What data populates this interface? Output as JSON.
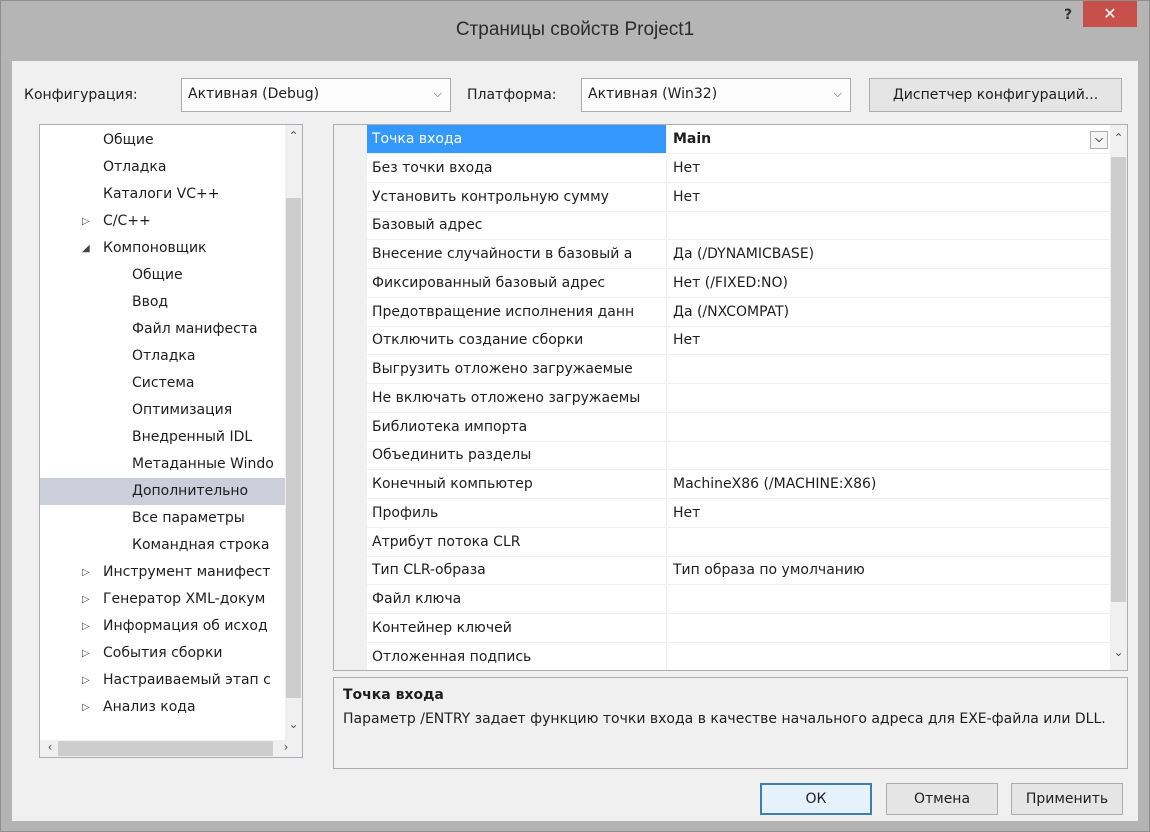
{
  "window": {
    "title": "Страницы свойств Project1",
    "help_label": "?",
    "close_label": "✕"
  },
  "toolbar": {
    "config_label": "Конфигурация:",
    "config_value": "Активная (Debug)",
    "platform_label": "Платформа:",
    "platform_value": "Активная (Win32)",
    "config_manager_label": "Диспетчер конфигураций..."
  },
  "tree": {
    "items": [
      {
        "label": "Общие",
        "indent": 0,
        "toggle": ""
      },
      {
        "label": "Отладка",
        "indent": 0,
        "toggle": ""
      },
      {
        "label": "Каталоги VC++",
        "indent": 0,
        "toggle": ""
      },
      {
        "label": "C/C++",
        "indent": 0,
        "toggle": "▷"
      },
      {
        "label": "Компоновщик",
        "indent": 0,
        "toggle": "◢"
      },
      {
        "label": "Общие",
        "indent": 1,
        "toggle": ""
      },
      {
        "label": "Ввод",
        "indent": 1,
        "toggle": ""
      },
      {
        "label": "Файл манифеста",
        "indent": 1,
        "toggle": ""
      },
      {
        "label": "Отладка",
        "indent": 1,
        "toggle": ""
      },
      {
        "label": "Система",
        "indent": 1,
        "toggle": ""
      },
      {
        "label": "Оптимизация",
        "indent": 1,
        "toggle": ""
      },
      {
        "label": "Внедренный IDL",
        "indent": 1,
        "toggle": ""
      },
      {
        "label": "Метаданные Windo",
        "indent": 1,
        "toggle": ""
      },
      {
        "label": "Дополнительно",
        "indent": 1,
        "toggle": "",
        "selected": true
      },
      {
        "label": "Все параметры",
        "indent": 1,
        "toggle": ""
      },
      {
        "label": "Командная строка",
        "indent": 1,
        "toggle": ""
      },
      {
        "label": "Инструмент манифест",
        "indent": 0,
        "toggle": "▷"
      },
      {
        "label": "Генератор XML-докум",
        "indent": 0,
        "toggle": "▷"
      },
      {
        "label": "Информация об исход",
        "indent": 0,
        "toggle": "▷"
      },
      {
        "label": "События сборки",
        "indent": 0,
        "toggle": "▷"
      },
      {
        "label": "Настраиваемый этап с",
        "indent": 0,
        "toggle": "▷"
      },
      {
        "label": "Анализ кода",
        "indent": 0,
        "toggle": "▷"
      }
    ]
  },
  "grid": {
    "rows": [
      {
        "name": "Точка входа",
        "value": "Main",
        "selected": true
      },
      {
        "name": "Без точки входа",
        "value": "Нет"
      },
      {
        "name": "Установить контрольную сумму",
        "value": "Нет"
      },
      {
        "name": "Базовый адрес",
        "value": ""
      },
      {
        "name": "Внесение случайности в базовый а",
        "value": "Да (/DYNAMICBASE)"
      },
      {
        "name": "Фиксированный базовый адрес",
        "value": "Нет (/FIXED:NO)"
      },
      {
        "name": "Предотвращение исполнения данн",
        "value": "Да (/NXCOMPAT)"
      },
      {
        "name": "Отключить создание сборки",
        "value": "Нет"
      },
      {
        "name": "Выгрузить отложено загружаемые",
        "value": ""
      },
      {
        "name": "Не включать отложено загружаемы",
        "value": ""
      },
      {
        "name": "Библиотека импорта",
        "value": ""
      },
      {
        "name": "Объединить разделы",
        "value": ""
      },
      {
        "name": "Конечный компьютер",
        "value": "MachineX86 (/MACHINE:X86)"
      },
      {
        "name": "Профиль",
        "value": "Нет"
      },
      {
        "name": "Атрибут потока CLR",
        "value": ""
      },
      {
        "name": "Тип CLR-образа",
        "value": "Тип образа по умолчанию"
      },
      {
        "name": "Файл ключа",
        "value": ""
      },
      {
        "name": "Контейнер ключей",
        "value": ""
      },
      {
        "name": "Отложенная подпись",
        "value": ""
      }
    ]
  },
  "description": {
    "title": "Точка входа",
    "text": "Параметр /ENTRY задает функцию точки входа в качестве начального адреса для EXE-файла или DLL."
  },
  "buttons": {
    "ok": "ОК",
    "cancel": "Отмена",
    "apply": "Применить"
  },
  "colors": {
    "selected_property": "#3399ff",
    "selected_tree_item": "#cccedb",
    "close_button": "#c7504b"
  }
}
